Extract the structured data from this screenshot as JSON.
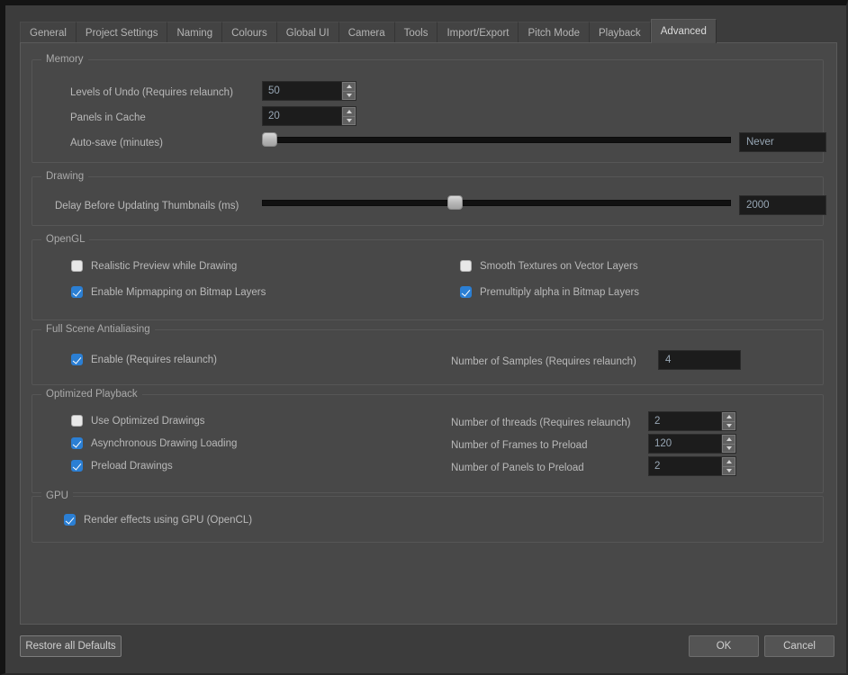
{
  "window": {
    "tabs": [
      {
        "label": "General",
        "active": false
      },
      {
        "label": "Project Settings",
        "active": false
      },
      {
        "label": "Naming",
        "active": false
      },
      {
        "label": "Colours",
        "active": false
      },
      {
        "label": "Global UI",
        "active": false
      },
      {
        "label": "Camera",
        "active": false
      },
      {
        "label": "Tools",
        "active": false
      },
      {
        "label": "Import/Export",
        "active": false
      },
      {
        "label": "Pitch Mode",
        "active": false
      },
      {
        "label": "Playback",
        "active": false
      },
      {
        "label": "Advanced",
        "active": true
      }
    ]
  },
  "memory": {
    "title": "Memory",
    "levels_of_undo": {
      "label": "Levels of Undo (Requires relaunch)",
      "value": "50"
    },
    "panels_in_cache": {
      "label": "Panels in Cache",
      "value": "20"
    },
    "auto_save": {
      "label": "Auto-save (minutes)",
      "value": "Never",
      "slider_percent": 0
    }
  },
  "drawing": {
    "title": "Drawing",
    "delay_thumbnails": {
      "label": "Delay Before Updating Thumbnails (ms)",
      "value": "2000",
      "slider_percent": 41
    }
  },
  "opengl": {
    "title": "OpenGL",
    "realistic_preview": {
      "label": "Realistic Preview while Drawing",
      "checked": false
    },
    "smooth_textures": {
      "label": "Smooth Textures on Vector Layers",
      "checked": false
    },
    "enable_mipmapping": {
      "label": "Enable Mipmapping on Bitmap Layers",
      "checked": true
    },
    "premultiply_alpha": {
      "label": "Premultiply alpha in Bitmap Layers",
      "checked": true
    }
  },
  "antialiasing": {
    "title": "Full Scene Antialiasing",
    "enable": {
      "label": "Enable (Requires relaunch)",
      "checked": true
    },
    "samples": {
      "label": "Number of Samples (Requires relaunch)",
      "value": "4"
    }
  },
  "optimized_playback": {
    "title": "Optimized Playback",
    "use_optimized_drawings": {
      "label": "Use Optimized Drawings",
      "checked": false
    },
    "async_drawing_loading": {
      "label": "Asynchronous Drawing Loading",
      "checked": true
    },
    "preload_drawings": {
      "label": "Preload Drawings",
      "checked": true
    },
    "threads": {
      "label": "Number of threads (Requires relaunch)",
      "value": "2"
    },
    "frames_preload": {
      "label": "Number of Frames to Preload",
      "value": "120"
    },
    "panels_preload": {
      "label": "Number of Panels to Preload",
      "value": "2"
    }
  },
  "gpu": {
    "title": "GPU",
    "render_effects": {
      "label": "Render effects using GPU (OpenCL)",
      "checked": true
    }
  },
  "footer": {
    "restore_defaults": "Restore all Defaults",
    "ok": "OK",
    "cancel": "Cancel"
  }
}
